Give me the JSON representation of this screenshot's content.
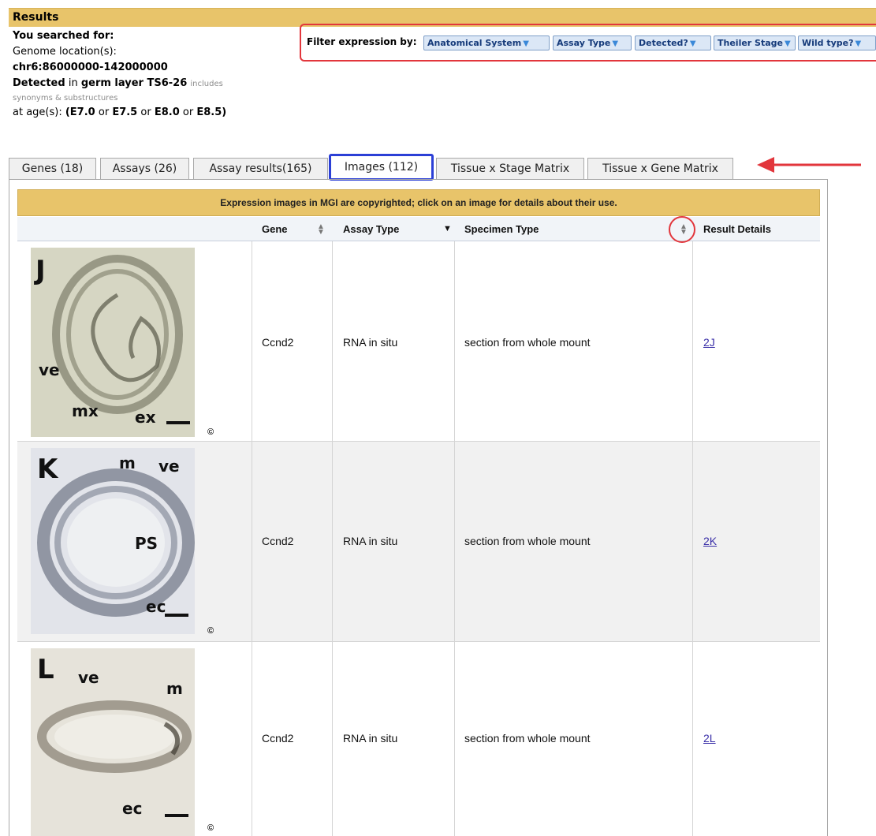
{
  "results": {
    "title": "Results"
  },
  "search": {
    "heading": "You searched for:",
    "genome_label": "Genome location(s):",
    "genome_value": "chr6:86000000-142000000",
    "detected_word": "Detected",
    "in_word": "in",
    "structure": "germ layer TS6-26",
    "includes": "includes",
    "synonyms": "synonyms & substructures",
    "age_label": "at age(s):",
    "age_open": "(E7.0",
    "age_or1": "or",
    "age_v2": "E7.5",
    "age_or2": "or",
    "age_v3": "E8.0",
    "age_or3": "or",
    "age_v4": "E8.5)"
  },
  "filter": {
    "label": "Filter expression by:",
    "buttons": [
      "Anatomical System",
      "Assay Type",
      "Detected?",
      "Theiler Stage",
      "Wild type?"
    ]
  },
  "tabs": [
    "Genes (18)",
    "Assays (26)",
    "Assay results(165)",
    "Images (112)",
    "Tissue x Stage Matrix",
    "Tissue x Gene Matrix"
  ],
  "notice": "Expression images in MGI are copyrighted; click on an image for details about their use.",
  "columns": {
    "gene": "Gene",
    "assay_type": "Assay Type",
    "specimen_type": "Specimen Type",
    "result_details": "Result Details"
  },
  "rows": [
    {
      "panel_letter": "J",
      "labels": [
        "ve",
        "mx",
        "ex"
      ],
      "copyright": "©",
      "gene": "Ccnd2",
      "assay": "RNA in situ",
      "specimen": "section from whole mount",
      "details": "2J"
    },
    {
      "panel_letter": "K",
      "labels": [
        "m",
        "ve",
        "PS",
        "ec"
      ],
      "copyright": "©",
      "gene": "Ccnd2",
      "assay": "RNA in situ",
      "specimen": "section from whole mount",
      "details": "2K"
    },
    {
      "panel_letter": "L",
      "labels": [
        "ve",
        "m",
        "ec"
      ],
      "copyright": "©",
      "gene": "Ccnd2",
      "assay": "RNA in situ",
      "specimen": "section from whole mount",
      "details": "2L"
    }
  ]
}
